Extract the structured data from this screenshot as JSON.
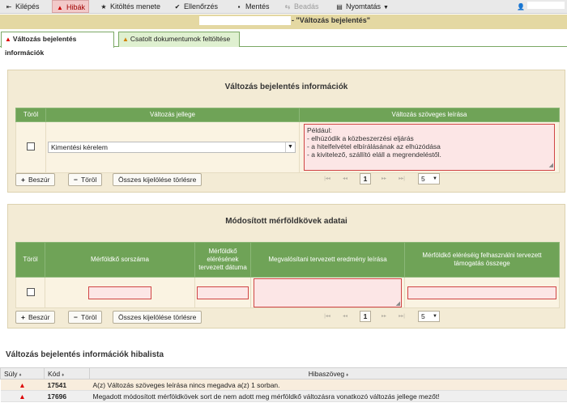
{
  "toolbar": {
    "items": [
      {
        "label": "Kilépés",
        "icon": "door-exit-icon"
      },
      {
        "label": "Hibák",
        "icon": "warning-icon"
      },
      {
        "label": "Kitöltés menete",
        "icon": "star-icon"
      },
      {
        "label": "Ellenőrzés",
        "icon": "check-icon"
      },
      {
        "label": "Mentés",
        "icon": "save-icon"
      },
      {
        "label": "Beadás",
        "icon": "send-icon"
      },
      {
        "label": "Nyomtatás",
        "icon": "print-icon"
      }
    ],
    "user_icon": "user-icon"
  },
  "document": {
    "title": "- \"Változás bejelentés\""
  },
  "tabs": [
    {
      "label": "Változás bejelentés információk",
      "icon": "warning-icon",
      "active": true
    },
    {
      "label": "Csatolt dokumentumok feltöltése",
      "icon": "warning-icon",
      "active": false
    }
  ],
  "panel1": {
    "title": "Változás bejelentés információk",
    "headers": {
      "torol": "Töröl",
      "jelleg": "Változás jellege",
      "leiras": "Változás szöveges leírása"
    },
    "row": {
      "jelleg_value": "Kimentési kérelem",
      "leiras_lines": [
        "Például:",
        "- elhúzódik a közbeszerzési eljárás",
        "- a hitelfelvétel elbírálásának az elhúzódása",
        "- a kivitelező, szállító eláll a megrendeléstől."
      ]
    },
    "buttons": {
      "add": "Beszúr",
      "delete": "Töröl",
      "clear": "Összes kijelölése törlésre"
    },
    "pager": {
      "page": "1",
      "page_size": "5"
    }
  },
  "panel2": {
    "title": "Módosított mérföldkövek adatai",
    "headers": {
      "torol": "Töröl",
      "sorszam": "Mérföldkő sorszáma",
      "datum": "Mérföldkő elérésének tervezett dátuma",
      "eredmeny": "Megvalósítani tervezett eredmény leírása",
      "osszeg": "Mérföldkő eléréséig felhasználni tervezett támogatás összege"
    },
    "buttons": {
      "add": "Beszúr",
      "delete": "Töröl",
      "clear": "Összes kijelölése törlésre"
    },
    "pager": {
      "page": "1",
      "page_size": "5"
    }
  },
  "errlist": {
    "title": "Változás bejelentés információk hibalista",
    "headers": {
      "sev": "Súly",
      "code": "Kód",
      "text": "Hibaszöveg"
    },
    "rows": [
      {
        "code": "17541",
        "text": "A(z) Változás szöveges leírása nincs megadva a(z) 1 sorban."
      },
      {
        "code": "17696",
        "text": "Megadott módosított mérföldkövek sort de nem adott meg mérföldkő változásra vonatkozó változás jellege mezőt!"
      }
    ]
  },
  "colors": {
    "header_green": "#6fa357",
    "panel_bg": "#f3ebd5",
    "error_red": "#d04545",
    "title_bar": "#e4d8a2"
  }
}
